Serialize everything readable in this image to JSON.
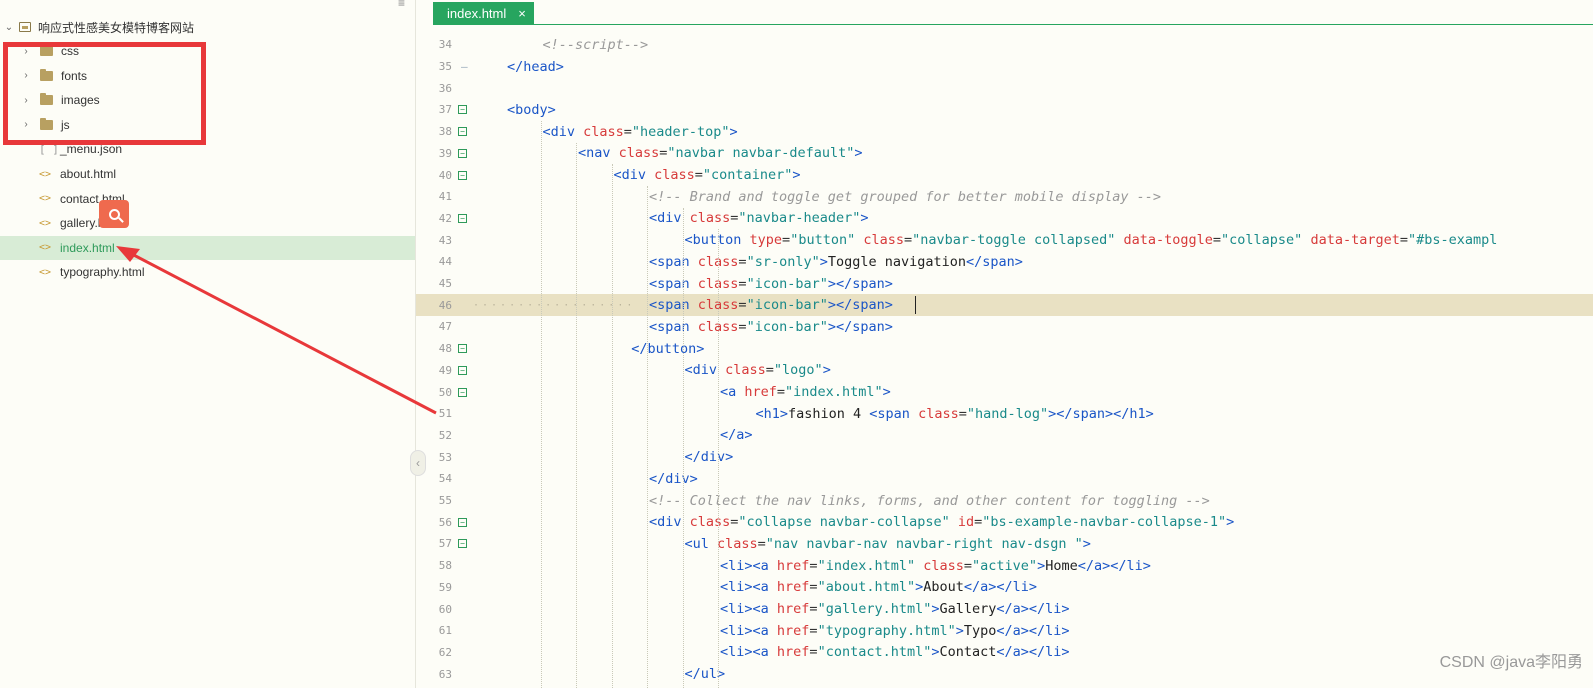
{
  "sidebar": {
    "root": {
      "label": "响应式性感美女模特博客网站"
    },
    "items": [
      {
        "label": "css",
        "type": "folder"
      },
      {
        "label": "fonts",
        "type": "folder"
      },
      {
        "label": "images",
        "type": "folder"
      },
      {
        "label": "js",
        "type": "folder"
      },
      {
        "label": "_menu.json",
        "type": "json"
      },
      {
        "label": "about.html",
        "type": "html"
      },
      {
        "label": "contact.html",
        "type": "html"
      },
      {
        "label": "gallery.html",
        "type": "html"
      },
      {
        "label": "index.html",
        "type": "html",
        "selected": true
      },
      {
        "label": "typography.html",
        "type": "html"
      }
    ]
  },
  "editor": {
    "tab": {
      "label": "index.html",
      "close": "×"
    },
    "lines": [
      {
        "n": "34",
        "fold": "",
        "indent": 1,
        "html": "<span class=\"tk-com\">&lt;!--script--&gt;</span>"
      },
      {
        "n": "35",
        "fold": "-",
        "indent": 0,
        "html": "<span class=\"tk-tag\">&lt;/head&gt;</span>"
      },
      {
        "n": "36",
        "fold": "",
        "indent": 0,
        "html": ""
      },
      {
        "n": "37",
        "fold": "box",
        "indent": 0,
        "html": "<span class=\"tk-tag\">&lt;body&gt;</span>"
      },
      {
        "n": "38",
        "fold": "box",
        "indent": 1,
        "html": "<span class=\"tk-tag\">&lt;div </span><span class=\"tk-attr\">class</span>=<span class=\"tk-str\">\"header-top\"</span><span class=\"tk-tag\">&gt;</span>"
      },
      {
        "n": "39",
        "fold": "box",
        "indent": 2,
        "html": "<span class=\"tk-tag\">&lt;nav </span><span class=\"tk-attr\">class</span>=<span class=\"tk-str\">\"navbar navbar-default\"</span><span class=\"tk-tag\">&gt;</span>"
      },
      {
        "n": "40",
        "fold": "box",
        "indent": 3,
        "html": "<span class=\"tk-tag\">&lt;div </span><span class=\"tk-attr\">class</span>=<span class=\"tk-str\">\"container\"</span><span class=\"tk-tag\">&gt;</span>"
      },
      {
        "n": "41",
        "fold": "",
        "indent": 4,
        "html": "<span class=\"tk-com\">&lt;!-- Brand and toggle get grouped for better mobile display --&gt;</span>"
      },
      {
        "n": "42",
        "fold": "box",
        "indent": 4,
        "html": "<span class=\"tk-tag\">&lt;div </span><span class=\"tk-attr\">class</span>=<span class=\"tk-str\">\"navbar-header\"</span><span class=\"tk-tag\">&gt;</span>"
      },
      {
        "n": "43",
        "fold": "",
        "indent": 5,
        "html": "<span class=\"tk-tag\">&lt;button </span><span class=\"tk-attr\">type</span>=<span class=\"tk-str\">\"button\"</span> <span class=\"tk-attr\">class</span>=<span class=\"tk-str\">\"navbar-toggle collapsed\"</span> <span class=\"tk-attr\">data-toggle</span>=<span class=\"tk-str\">\"collapse\"</span> <span class=\"tk-attr\">data-target</span>=<span class=\"tk-str\">\"#bs-exampl</span>"
      },
      {
        "n": "44",
        "fold": "",
        "indent": 4,
        "html": "<span class=\"tk-tag\">&lt;span </span><span class=\"tk-attr\">class</span>=<span class=\"tk-str\">\"sr-only\"</span><span class=\"tk-tag\">&gt;</span><span class=\"tk-txt\">Toggle navigation</span><span class=\"tk-tag\">&lt;/span&gt;</span>"
      },
      {
        "n": "45",
        "fold": "",
        "indent": 4,
        "html": "<span class=\"tk-tag\">&lt;span </span><span class=\"tk-attr\">class</span>=<span class=\"tk-str\">\"icon-bar\"</span><span class=\"tk-tag\">&gt;&lt;/span&gt;</span>"
      },
      {
        "n": "46",
        "fold": "",
        "indent": 4,
        "current": true,
        "html": "<span class=\"tk-tag\">&lt;span </span><span class=\"tk-attr\">class</span>=<span class=\"tk-str\">\"icon-bar\"</span><span class=\"tk-tag\">&gt;&lt;/span&gt;</span>"
      },
      {
        "n": "47",
        "fold": "",
        "indent": 4,
        "html": "<span class=\"tk-tag\">&lt;span </span><span class=\"tk-attr\">class</span>=<span class=\"tk-str\">\"icon-bar\"</span><span class=\"tk-tag\">&gt;&lt;/span&gt;</span>"
      },
      {
        "n": "48",
        "fold": "box",
        "indent": 3.5,
        "html": "<span class=\"tk-tag\">&lt;/button&gt;</span>"
      },
      {
        "n": "49",
        "fold": "box",
        "indent": 5,
        "html": "<span class=\"tk-tag\">&lt;div </span><span class=\"tk-attr\">class</span>=<span class=\"tk-str\">\"logo\"</span><span class=\"tk-tag\">&gt;</span>"
      },
      {
        "n": "50",
        "fold": "box",
        "indent": 6,
        "html": "<span class=\"tk-tag\">&lt;a </span><span class=\"tk-attr\">href</span>=<span class=\"tk-str\">\"index.html\"</span><span class=\"tk-tag\">&gt;</span>"
      },
      {
        "n": "51",
        "fold": "",
        "indent": 7,
        "html": "<span class=\"tk-tag\">&lt;h1&gt;</span><span class=\"tk-txt\">fashion 4 </span><span class=\"tk-tag\">&lt;span </span><span class=\"tk-attr\">class</span>=<span class=\"tk-str\">\"hand-log\"</span><span class=\"tk-tag\">&gt;&lt;/span&gt;&lt;/h1&gt;</span>"
      },
      {
        "n": "52",
        "fold": "",
        "indent": 6,
        "html": "<span class=\"tk-tag\">&lt;/a&gt;</span>"
      },
      {
        "n": "53",
        "fold": "",
        "indent": 5,
        "html": "<span class=\"tk-tag\">&lt;/div&gt;</span>"
      },
      {
        "n": "54",
        "fold": "",
        "indent": 4,
        "html": "<span class=\"tk-tag\">&lt;/div&gt;</span>"
      },
      {
        "n": "55",
        "fold": "",
        "indent": 4,
        "html": "<span class=\"tk-com\">&lt;!-- Collect the nav links, forms, and other content for toggling --&gt;</span>"
      },
      {
        "n": "56",
        "fold": "box",
        "indent": 4,
        "html": "<span class=\"tk-tag\">&lt;div </span><span class=\"tk-attr\">class</span>=<span class=\"tk-str\">\"collapse navbar-collapse\"</span> <span class=\"tk-attr\">id</span>=<span class=\"tk-str\">\"bs-example-navbar-collapse-1\"</span><span class=\"tk-tag\">&gt;</span>"
      },
      {
        "n": "57",
        "fold": "box",
        "indent": 5,
        "html": "<span class=\"tk-tag\">&lt;ul </span><span class=\"tk-attr\">class</span>=<span class=\"tk-str\">\"nav navbar-nav navbar-right nav-dsgn \"</span><span class=\"tk-tag\">&gt;</span>"
      },
      {
        "n": "58",
        "fold": "",
        "indent": 6,
        "html": "<span class=\"tk-tag\">&lt;li&gt;&lt;a </span><span class=\"tk-attr\">href</span>=<span class=\"tk-str\">\"index.html\"</span> <span class=\"tk-attr\">class</span>=<span class=\"tk-str\">\"active\"</span><span class=\"tk-tag\">&gt;</span><span class=\"tk-txt\">Home</span><span class=\"tk-tag\">&lt;/a&gt;&lt;/li&gt;</span>"
      },
      {
        "n": "59",
        "fold": "",
        "indent": 6,
        "html": "<span class=\"tk-tag\">&lt;li&gt;&lt;a </span><span class=\"tk-attr\">href</span>=<span class=\"tk-str\">\"about.html\"</span><span class=\"tk-tag\">&gt;</span><span class=\"tk-txt\">About</span><span class=\"tk-tag\">&lt;/a&gt;&lt;/li&gt;</span>"
      },
      {
        "n": "60",
        "fold": "",
        "indent": 6,
        "html": "<span class=\"tk-tag\">&lt;li&gt;&lt;a </span><span class=\"tk-attr\">href</span>=<span class=\"tk-str\">\"gallery.html\"</span><span class=\"tk-tag\">&gt;</span><span class=\"tk-txt\">Gallery</span><span class=\"tk-tag\">&lt;/a&gt;&lt;/li&gt;</span>"
      },
      {
        "n": "61",
        "fold": "",
        "indent": 6,
        "html": "<span class=\"tk-tag\">&lt;li&gt;&lt;a </span><span class=\"tk-attr\">href</span>=<span class=\"tk-str\">\"typography.html\"</span><span class=\"tk-tag\">&gt;</span><span class=\"tk-txt\">Typo</span><span class=\"tk-tag\">&lt;/a&gt;&lt;/li&gt;</span>"
      },
      {
        "n": "62",
        "fold": "",
        "indent": 6,
        "html": "<span class=\"tk-tag\">&lt;li&gt;&lt;a </span><span class=\"tk-attr\">href</span>=<span class=\"tk-str\">\"contact.html\"</span><span class=\"tk-tag\">&gt;</span><span class=\"tk-txt\">Contact</span><span class=\"tk-tag\">&lt;/a&gt;&lt;/li&gt;</span>"
      },
      {
        "n": "63",
        "fold": "",
        "indent": 5,
        "html": "<span class=\"tk-tag\">&lt;/ul&gt;</span>"
      }
    ]
  },
  "watermark": "CSDN @java李阳勇",
  "colors": {
    "accent": "#27a55f",
    "highlight_box": "#e8383a",
    "arrow": "#e8383a"
  }
}
